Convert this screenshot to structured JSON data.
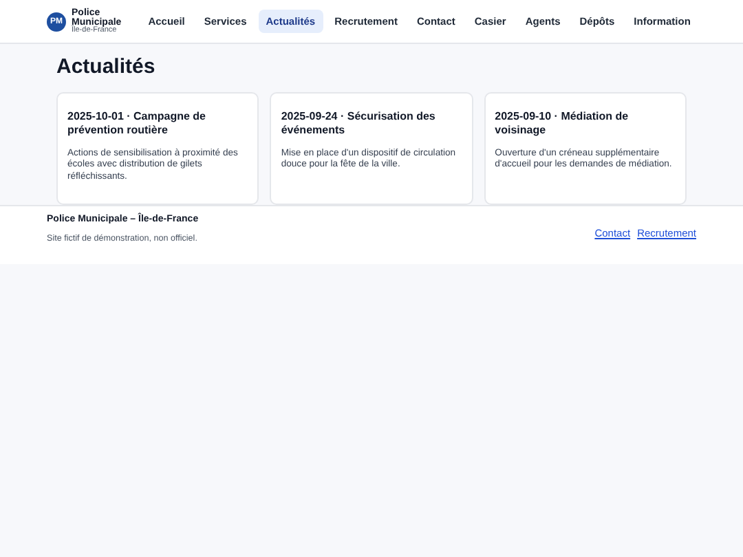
{
  "logo": {
    "badge": "PM",
    "name_line_1": "Police",
    "name_line_2": "Municipale",
    "region": "Île-de-France"
  },
  "nav": [
    {
      "label": "Accueil",
      "selected": false
    },
    {
      "label": "Services",
      "selected": false
    },
    {
      "label": "Actualités",
      "selected": true
    },
    {
      "label": "Recrutement",
      "selected": false
    },
    {
      "label": "Contact",
      "selected": false
    },
    {
      "label": "Casier",
      "selected": false
    },
    {
      "label": "Agents",
      "selected": false
    },
    {
      "label": "Dépôts",
      "selected": false
    },
    {
      "label": "Information",
      "selected": false
    }
  ],
  "heading": "Actualités",
  "news": [
    {
      "title": "2025-10-01 · Campagne de prévention routière",
      "body": "Actions de sensibilisation à proximité des écoles avec distribution de gilets réfléchissants."
    },
    {
      "title": "2025-09-24 · Sécurisation des événements",
      "body": "Mise en place d'un dispositif de circulation douce pour la fête de la ville."
    },
    {
      "title": "2025-09-10 · Médiation de voisinage",
      "body": "Ouverture d'un créneau supplémentaire d'accueil pour les demandes de médiation."
    }
  ],
  "footer": {
    "title": "Police Municipale – Île-de-France",
    "note": "Site fictif de démonstration, non officiel.",
    "links": [
      "Contact",
      "Recrutement"
    ]
  }
}
